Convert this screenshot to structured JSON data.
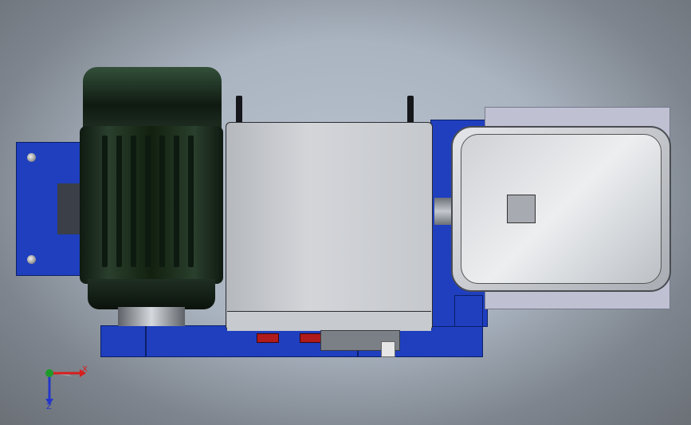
{
  "triad": {
    "x_label": "X",
    "z_label": "Z",
    "x_color": "#d81e1e",
    "z_color": "#2436c9",
    "y_color": "#1e9b2a"
  },
  "colors": {
    "frame_blue": "#1f3fbf",
    "motor_green": "#1a2a1c",
    "housing_grey": "#c9ccd1",
    "hopper_grey": "#d6d8dc"
  }
}
